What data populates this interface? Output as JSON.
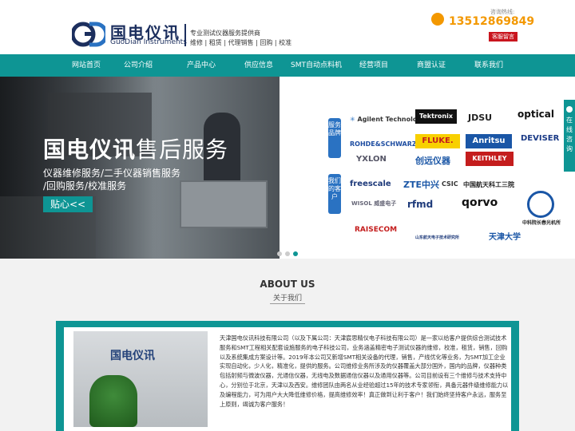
{
  "header": {
    "logo_cn": "国电仪讯",
    "logo_en": "GuoDian Instruments",
    "slogan_line1": "专业测试仪器服务提供商",
    "slogan_line2": "维修 | 租赁 | 代理销售 | 回购 | 校准",
    "phone_label": "咨询热线:",
    "phone_number": "13512869849",
    "message_button": "客服留言"
  },
  "nav": {
    "items": [
      "网站首页",
      "公司介绍",
      "产品中心",
      "供应信息",
      "SMT自动点料机",
      "经营项目",
      "商盟认证",
      "联系我们"
    ]
  },
  "hero": {
    "title_bold": "国电仪讯",
    "title_thin": "售后服务",
    "line1": "仪器维修服务/二手仪器销售服务",
    "line2": "/回购服务/校准服务",
    "button": "贴心<<",
    "active_slide": 3
  },
  "brands": {
    "tag_service": "服务品牌",
    "tag_clients": "我们的客户",
    "service_brands": [
      "Agilent Technologies",
      "Tektronix",
      "JDSU",
      "optical",
      "ROHDE&SCHWARZ",
      "FLUKE.",
      "Anritsu",
      "DEVISER",
      "YXLON",
      "创远仪器",
      "KEITHLEY"
    ],
    "clients": [
      "freescale",
      "ZTE中兴",
      "CSIC",
      "中国航天科工三院",
      "WISOL 威盛电子",
      "rfmd",
      "qorvo",
      "中科院长春光机所",
      "RAISECOM",
      "山东航天电子技术研究所",
      "天津大学"
    ]
  },
  "side_widget": {
    "label": "在线咨询",
    "up_icon": "^",
    "chat_icon": "?"
  },
  "about": {
    "title": "ABOUT US",
    "subtitle": "关于我们",
    "image_sign": "国电仪讯",
    "text": "天津国电仪讯科技有限公司（以及下属公司：天津宸思精仪电子科技有限公司）是一家以给客户提供综合测试技术服务和SMT工程相关配套设施服务的电子科技公司，业务涵盖精密电子测试仪器的维修，校准，租赁，销售，回购以及系统集成方案设计等。2019年本公司又新增SMT相关设备的代理，销售，产线优化等业务，为SMT加工企业实现自动化，少人化，精准化，提供的服务。公司维修业务所涉及的仪器覆盖大部分国外，国内的品牌，仪器种类包括射频与微波仪器，光通信仪器，无线电及数据通信仪器以及通用仪器等。公司目前设有三个维修与技术支持中心，分别位于北京，天津以及西安。维修团队由两名从业经验超过15年的技术专家领衔，具备元器件级维修能力以及编程能力，可为用户大大降低维修价格，提高维修效率！真正做到让利于客户！我们始终坚持客户永远，服务至上原则，竭诚为客户服务！"
  },
  "colors": {
    "teal": "#0e9594",
    "orange": "#f39800",
    "navy": "#1c2f5e",
    "red": "#c9151e"
  }
}
